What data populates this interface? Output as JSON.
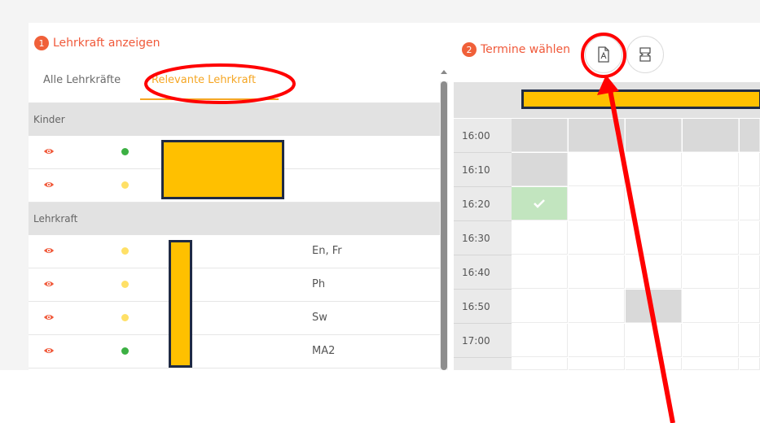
{
  "teacher_panel": {
    "step_number": "1",
    "title": "Lehrkraft anzeigen",
    "tabs": [
      {
        "label": "Alle Lehrkräfte",
        "active": false
      },
      {
        "label": "Relevante Lehrkraft",
        "active": true
      }
    ],
    "groups": [
      {
        "label": "Kinder",
        "rows": [
          {
            "status": "green",
            "subject": ""
          },
          {
            "status": "yellow",
            "subject": ""
          }
        ]
      },
      {
        "label": "Lehrkraft",
        "rows": [
          {
            "status": "yellow",
            "subject": "En, Fr"
          },
          {
            "status": "yellow",
            "subject": "Ph"
          },
          {
            "status": "yellow",
            "subject": "Sw"
          },
          {
            "status": "green",
            "subject": "MA2"
          }
        ]
      }
    ]
  },
  "appointment_panel": {
    "step_number": "2",
    "title": "Termine wählen",
    "toolbar": {
      "pdf_icon": "pdf-icon",
      "layout_icon": "layout-icon"
    },
    "times": [
      "16:00",
      "16:10",
      "16:20",
      "16:30",
      "16:40",
      "16:50",
      "17:00"
    ]
  },
  "colors": {
    "accent": "#f0593a",
    "tab_active": "#f5a623",
    "status_green": "#3cb043",
    "status_yellow": "#ffe066",
    "eye": "#f0593a",
    "booked": "#c2e5bf",
    "redaction": "#ffc000",
    "annotation": "#ff0000"
  }
}
